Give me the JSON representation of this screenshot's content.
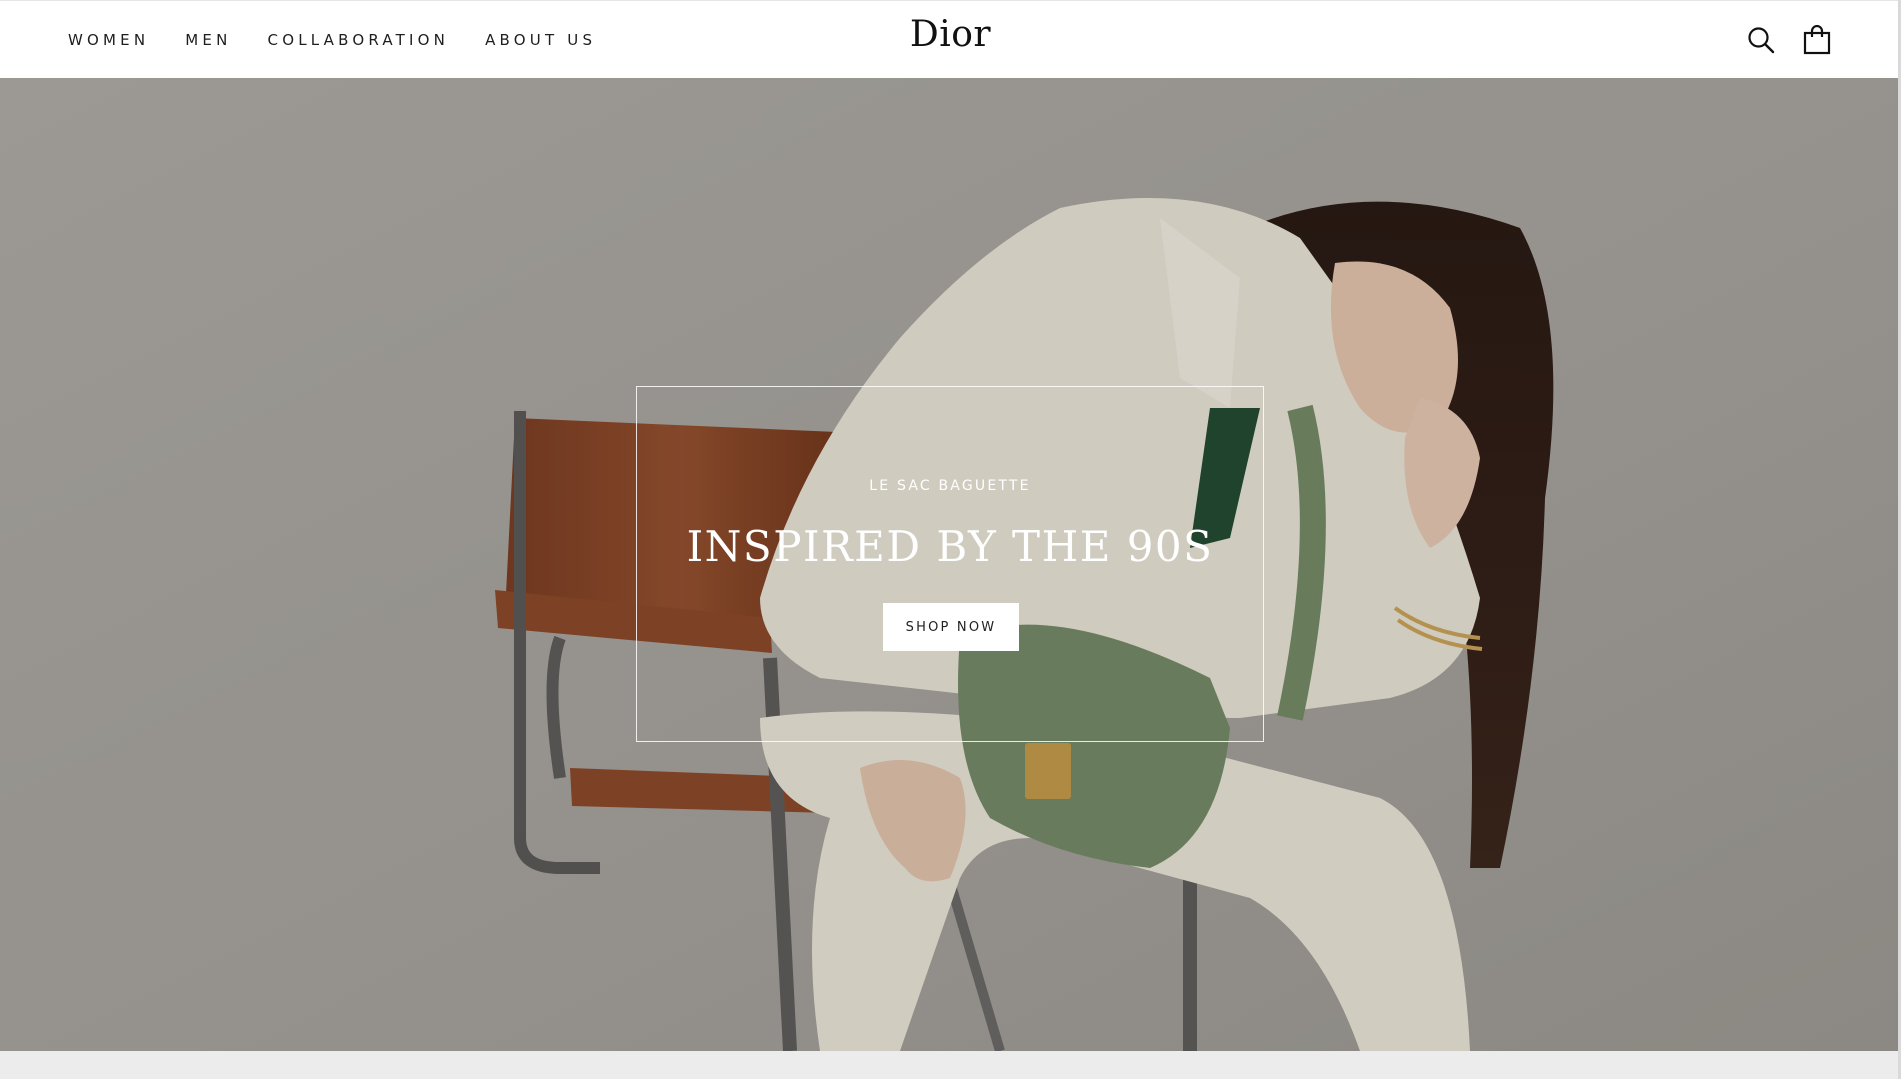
{
  "nav": {
    "items": [
      {
        "label": "WOMEN"
      },
      {
        "label": "MEN"
      },
      {
        "label": "COLLABORATION"
      },
      {
        "label": "ABOUT US"
      }
    ]
  },
  "brand": {
    "logo": "Dior"
  },
  "header_icons": {
    "search": "search-icon",
    "cart": "shopping-bag-icon"
  },
  "hero": {
    "subtitle": "LE SAC BAGUETTE",
    "title": "INSPIRED BY THE 90S",
    "cta_label": "SHOP NOW",
    "image": "model-seated-on-leather-chair-with-green-bag"
  },
  "colors": {
    "header_bg": "#ffffff",
    "hero_bg": "#a9a6a2",
    "accent_text": "#ffffff",
    "cta_bg": "#ffffff"
  }
}
